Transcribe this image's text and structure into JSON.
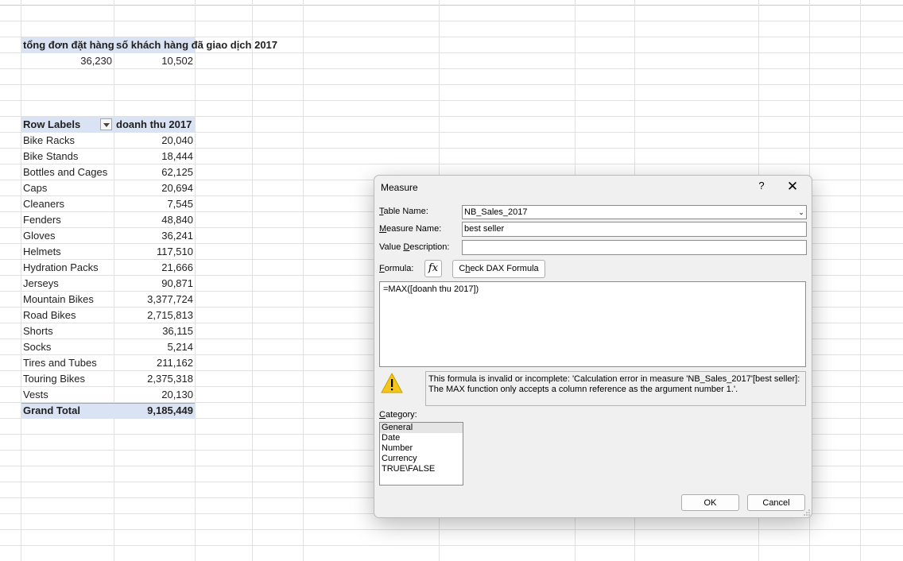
{
  "sheet": {
    "summary_headers": [
      "tổng đơn đặt hàng",
      "số khách hàng đã giao dịch 2017"
    ],
    "summary_values": [
      "36,230",
      "10,502"
    ],
    "pivot_header": {
      "row_labels": "Row Labels",
      "value_col": "doanh thu 2017"
    },
    "pivot_rows": [
      {
        "label": "Bike Racks",
        "value": "20,040"
      },
      {
        "label": "Bike Stands",
        "value": "18,444"
      },
      {
        "label": "Bottles and Cages",
        "value": "62,125"
      },
      {
        "label": "Caps",
        "value": "20,694"
      },
      {
        "label": "Cleaners",
        "value": "7,545"
      },
      {
        "label": "Fenders",
        "value": "48,840"
      },
      {
        "label": "Gloves",
        "value": "36,241"
      },
      {
        "label": "Helmets",
        "value": "117,510"
      },
      {
        "label": "Hydration Packs",
        "value": "21,666"
      },
      {
        "label": "Jerseys",
        "value": "90,871"
      },
      {
        "label": "Mountain Bikes",
        "value": "3,377,724"
      },
      {
        "label": "Road Bikes",
        "value": "2,715,813"
      },
      {
        "label": "Shorts",
        "value": "36,115"
      },
      {
        "label": "Socks",
        "value": "5,214"
      },
      {
        "label": "Tires and Tubes",
        "value": "211,162"
      },
      {
        "label": "Touring Bikes",
        "value": "2,375,318"
      },
      {
        "label": "Vests",
        "value": "20,130"
      }
    ],
    "grand_total": {
      "label": "Grand Total",
      "value": "9,185,449"
    },
    "header_band_color": "#dae3f3"
  },
  "dialog": {
    "title": "Measure",
    "help": "?",
    "close": "✕",
    "table_name_prefix": "T",
    "table_name_rest": "able Name:",
    "table_name_value": "NB_Sales_2017",
    "measure_name_prefix": "M",
    "measure_name_rest": "easure Name:",
    "measure_name_value": "best seller",
    "value_desc_pre": "Value ",
    "value_desc_ul": "D",
    "value_desc_rest": "escription:",
    "value_desc_value": "",
    "formula_prefix": "F",
    "formula_rest": "ormula:",
    "fx_label": "fx",
    "check_dax_pre": "C",
    "check_dax_ul": "h",
    "check_dax_rest": "eck DAX Formula",
    "formula_text": "=MAX([doanh thu 2017])",
    "error_text": "This formula is invalid or incomplete: 'Calculation error in measure 'NB_Sales_2017'[best seller]: The MAX function only accepts a column reference as the argument number 1.'.",
    "category_prefix": "C",
    "category_rest": "ategory:",
    "categories": [
      "General",
      "Date",
      "Number",
      "Currency",
      "TRUE\\FALSE"
    ],
    "ok_label": "OK",
    "cancel_label": "Cancel",
    "warning_color": "#f5c518"
  }
}
